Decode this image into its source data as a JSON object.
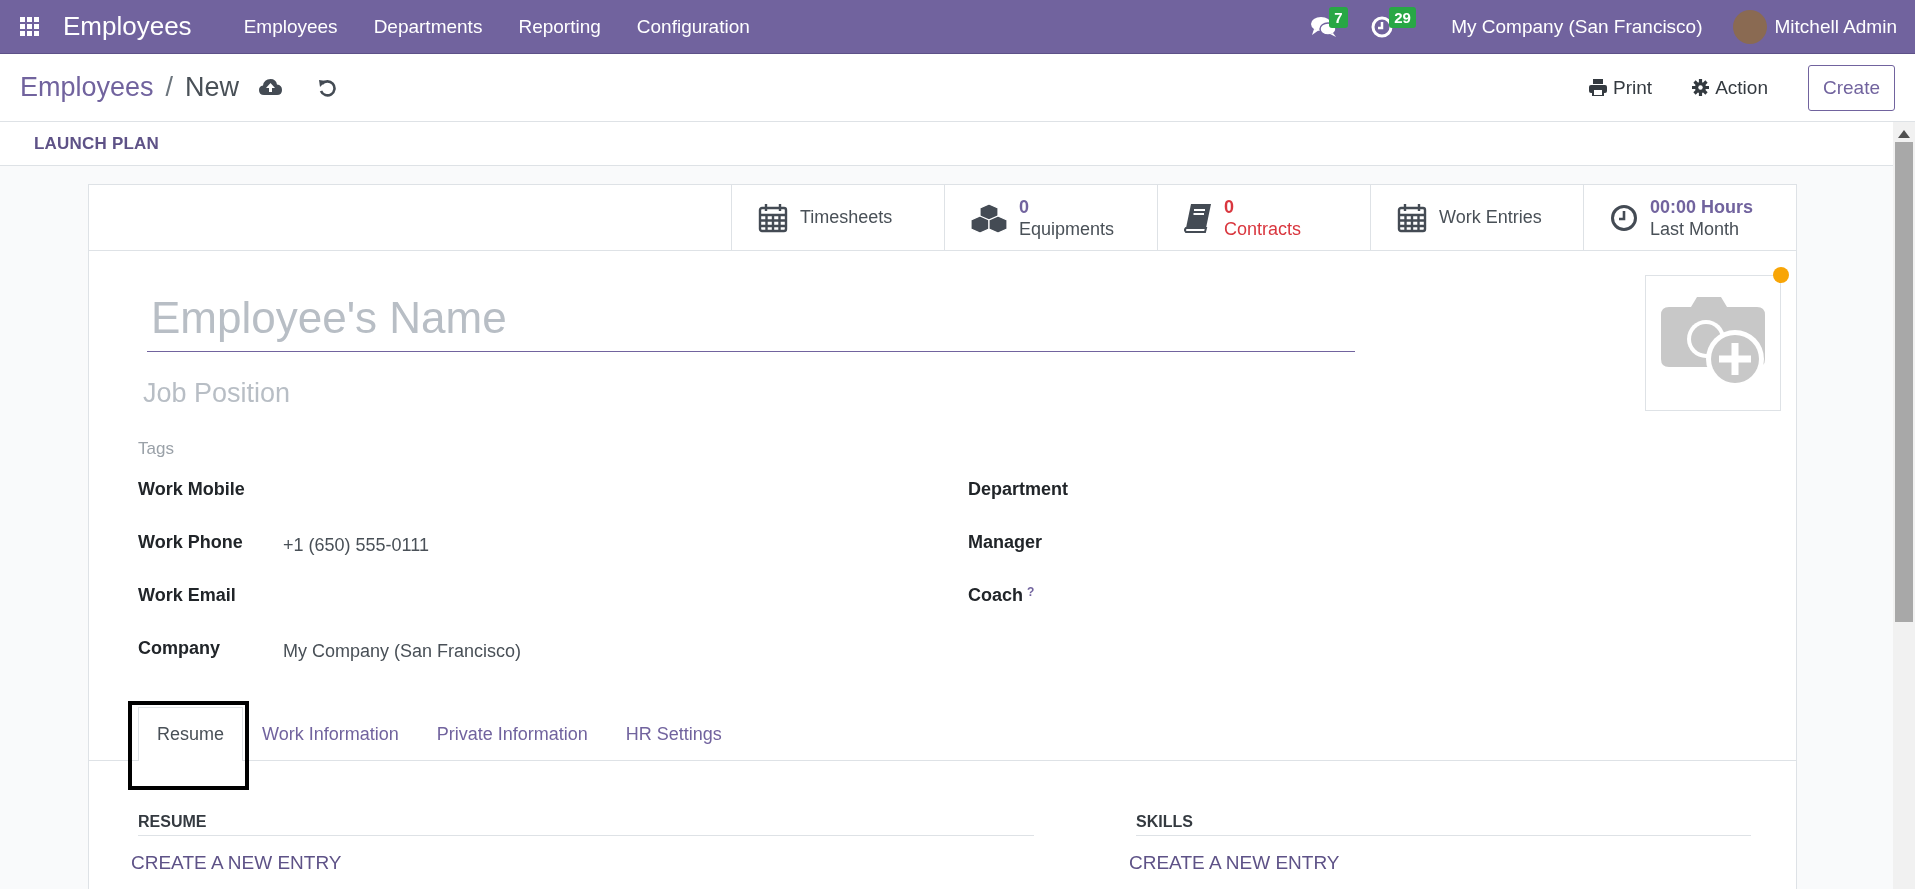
{
  "navbar": {
    "app_name": "Employees",
    "menu": [
      "Employees",
      "Departments",
      "Reporting",
      "Configuration"
    ],
    "messages_count": "7",
    "activities_count": "29",
    "company": "My Company (San Francisco)",
    "user": "Mitchell Admin"
  },
  "breadcrumb": {
    "parent": "Employees",
    "separator": "/",
    "current": "New"
  },
  "actions": {
    "print": "Print",
    "action": "Action",
    "create": "Create"
  },
  "launch_plan": "LAUNCH PLAN",
  "stat_buttons": [
    {
      "kind": "label",
      "label": "Timesheets"
    },
    {
      "kind": "value",
      "value": "0",
      "label": "Equipments",
      "alert": false
    },
    {
      "kind": "value",
      "value": "0",
      "label": "Contracts",
      "alert": true
    },
    {
      "kind": "label",
      "label": "Work Entries"
    },
    {
      "kind": "value",
      "value": "00:00 Hours",
      "label": "Last Month",
      "alert": false
    }
  ],
  "name_placeholder": "Employee's Name",
  "job_placeholder": "Job Position",
  "tags_placeholder": "Tags",
  "left_fields": [
    {
      "label": "Work Mobile"
    },
    {
      "label": "Work Phone",
      "value": "+1 (650) 555-0111"
    },
    {
      "label": "Work Email"
    },
    {
      "label": "Company",
      "value": "My Company (San Francisco)"
    }
  ],
  "right_fields": [
    {
      "label": "Department"
    },
    {
      "label": "Manager"
    },
    {
      "label": "Coach",
      "help": "?"
    }
  ],
  "tabs": [
    {
      "label": "Resume",
      "selected": true,
      "highlighted": true
    },
    {
      "label": "Work Information",
      "selected": false,
      "highlighted": false
    },
    {
      "label": "Private Information",
      "selected": false,
      "highlighted": false
    },
    {
      "label": "HR Settings",
      "selected": false,
      "highlighted": false
    }
  ],
  "sections": [
    {
      "title": "RESUME",
      "action": "CREATE A NEW ENTRY"
    },
    {
      "title": "SKILLS",
      "action": "CREATE A NEW ENTRY"
    }
  ]
}
